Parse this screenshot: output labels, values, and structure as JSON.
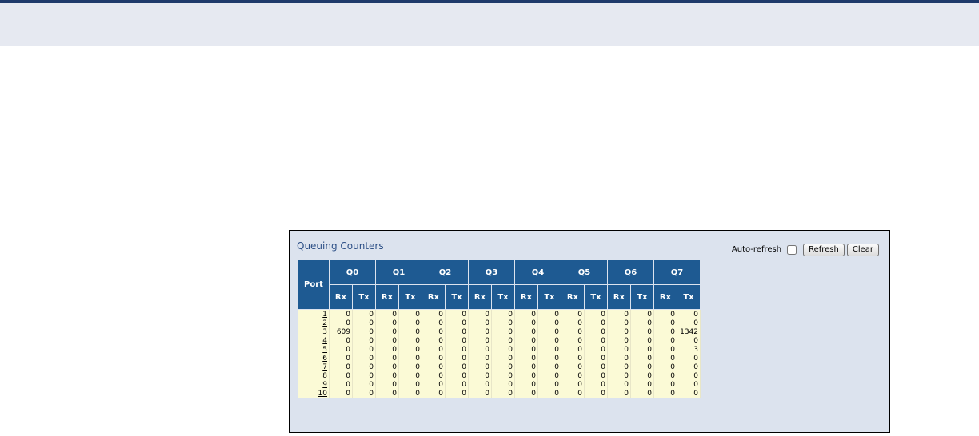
{
  "panel": {
    "title": "Queuing Counters",
    "auto_refresh_label": "Auto-refresh",
    "auto_refresh_checked": false,
    "refresh_label": "Refresh",
    "clear_label": "Clear"
  },
  "table": {
    "port_header": "Port",
    "queues": [
      "Q0",
      "Q1",
      "Q2",
      "Q3",
      "Q4",
      "Q5",
      "Q6",
      "Q7"
    ],
    "rx_label": "Rx",
    "tx_label": "Tx",
    "rows": [
      {
        "port": "1",
        "values": [
          "0",
          "0",
          "0",
          "0",
          "0",
          "0",
          "0",
          "0",
          "0",
          "0",
          "0",
          "0",
          "0",
          "0",
          "0",
          "0"
        ]
      },
      {
        "port": "2",
        "values": [
          "0",
          "0",
          "0",
          "0",
          "0",
          "0",
          "0",
          "0",
          "0",
          "0",
          "0",
          "0",
          "0",
          "0",
          "0",
          "0"
        ]
      },
      {
        "port": "3",
        "values": [
          "609",
          "0",
          "0",
          "0",
          "0",
          "0",
          "0",
          "0",
          "0",
          "0",
          "0",
          "0",
          "0",
          "0",
          "0",
          "1342"
        ]
      },
      {
        "port": "4",
        "values": [
          "0",
          "0",
          "0",
          "0",
          "0",
          "0",
          "0",
          "0",
          "0",
          "0",
          "0",
          "0",
          "0",
          "0",
          "0",
          "0"
        ]
      },
      {
        "port": "5",
        "values": [
          "0",
          "0",
          "0",
          "0",
          "0",
          "0",
          "0",
          "0",
          "0",
          "0",
          "0",
          "0",
          "0",
          "0",
          "0",
          "3"
        ]
      },
      {
        "port": "6",
        "values": [
          "0",
          "0",
          "0",
          "0",
          "0",
          "0",
          "0",
          "0",
          "0",
          "0",
          "0",
          "0",
          "0",
          "0",
          "0",
          "0"
        ]
      },
      {
        "port": "7",
        "values": [
          "0",
          "0",
          "0",
          "0",
          "0",
          "0",
          "0",
          "0",
          "0",
          "0",
          "0",
          "0",
          "0",
          "0",
          "0",
          "0"
        ]
      },
      {
        "port": "8",
        "values": [
          "0",
          "0",
          "0",
          "0",
          "0",
          "0",
          "0",
          "0",
          "0",
          "0",
          "0",
          "0",
          "0",
          "0",
          "0",
          "0"
        ]
      },
      {
        "port": "9",
        "values": [
          "0",
          "0",
          "0",
          "0",
          "0",
          "0",
          "0",
          "0",
          "0",
          "0",
          "0",
          "0",
          "0",
          "0",
          "0",
          "0"
        ]
      },
      {
        "port": "10",
        "values": [
          "0",
          "0",
          "0",
          "0",
          "0",
          "0",
          "0",
          "0",
          "0",
          "0",
          "0",
          "0",
          "0",
          "0",
          "0",
          "0"
        ]
      }
    ]
  }
}
